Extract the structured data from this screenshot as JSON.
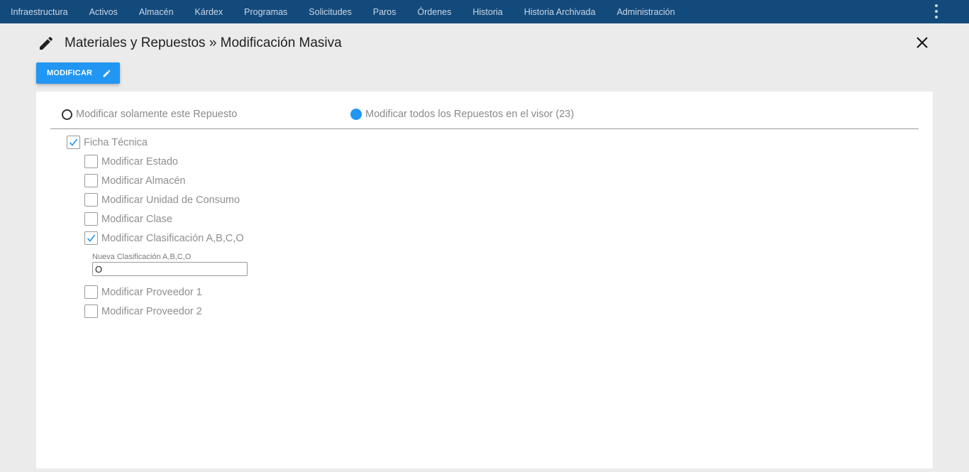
{
  "nav": {
    "items": [
      "Infraestructura",
      "Activos",
      "Almacén",
      "Kárdex",
      "Programas",
      "Solicitudes",
      "Paros",
      "Órdenes",
      "Historia",
      "Historia Archivada",
      "Administración"
    ]
  },
  "header": {
    "title": "Materiales y Repuestos » Modificación Masiva"
  },
  "toolbar": {
    "modify_label": "MODIFICAR"
  },
  "scope": {
    "option_single": "Modificar solamente este Repuesto",
    "option_all": "Modificar todos los Repuestos en el visor (23)",
    "selected": "all"
  },
  "form": {
    "ficha_tecnica": {
      "label": "Ficha Técnica",
      "checked": true
    },
    "options": [
      {
        "label": "Modificar Estado",
        "checked": false
      },
      {
        "label": "Modificar Almacén",
        "checked": false
      },
      {
        "label": "Modificar Unidad de Consumo",
        "checked": false
      },
      {
        "label": "Modificar Clase",
        "checked": false
      },
      {
        "label": "Modificar Clasificación A,B,C,O",
        "checked": true
      },
      {
        "label": "Modificar Proveedor 1",
        "checked": false
      },
      {
        "label": "Modificar Proveedor 2",
        "checked": false
      }
    ],
    "nueva_clasificacion": {
      "label": "Nueva Clasificación A,B,C,O",
      "value": "O"
    }
  },
  "colors": {
    "nav_bg": "#134a7c",
    "accent": "#2196f3"
  }
}
